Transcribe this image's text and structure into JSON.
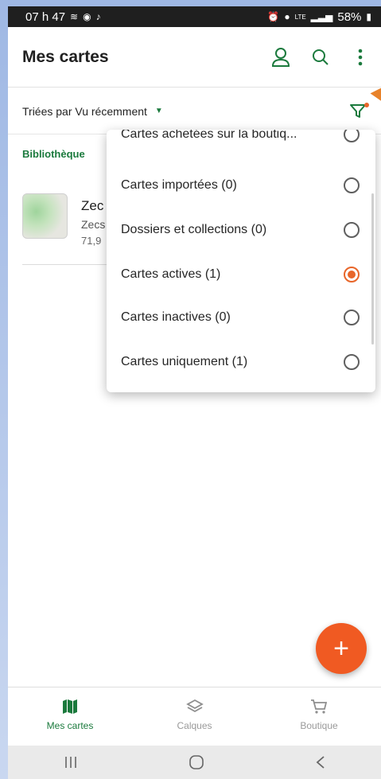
{
  "status_bar": {
    "time": "07 h 47",
    "battery": "58%",
    "network": "LTE"
  },
  "app_bar": {
    "title": "Mes cartes",
    "icons": [
      "user-icon",
      "search-icon",
      "more-vert-icon"
    ]
  },
  "sort": {
    "label": "Triées par Vu récemment"
  },
  "library": {
    "section_title": "Bibliothèque",
    "item": {
      "title": "Zec",
      "subtitle": "Zecs",
      "size": "71,9"
    }
  },
  "filter_menu": {
    "items": [
      {
        "label": "Cartes achetées sur la boutiq...",
        "selected": false
      },
      {
        "label": "Cartes importées (0)",
        "selected": false
      },
      {
        "label": "Dossiers et collections (0)",
        "selected": false
      },
      {
        "label": "Cartes actives (1)",
        "selected": true
      },
      {
        "label": "Cartes inactives (0)",
        "selected": false
      },
      {
        "label": "Cartes uniquement (1)",
        "selected": false
      }
    ]
  },
  "fab": {
    "label": "+"
  },
  "bottom_nav": {
    "items": [
      {
        "label": "Mes cartes",
        "icon": "map-icon",
        "active": true
      },
      {
        "label": "Calques",
        "icon": "layers-icon",
        "active": false
      },
      {
        "label": "Boutique",
        "icon": "cart-icon",
        "active": false
      }
    ]
  },
  "colors": {
    "accent": "#1b7a3d",
    "orange": "#f05a22"
  }
}
